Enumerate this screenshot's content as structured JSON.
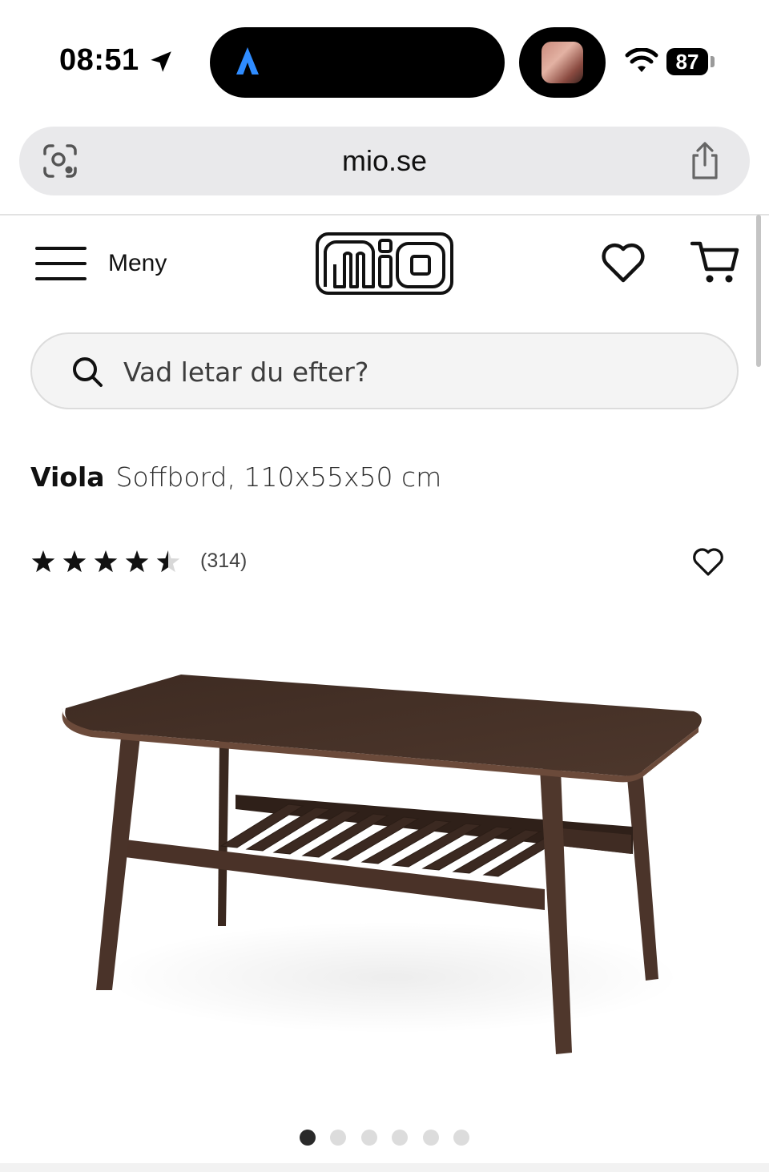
{
  "status_bar": {
    "time": "08:51",
    "battery": "87",
    "icons": [
      "location-arrow-icon",
      "navigation-a-icon",
      "wifi-icon",
      "battery-icon"
    ]
  },
  "browser": {
    "url": "mio.se",
    "icons": [
      "lens-icon",
      "share-icon"
    ]
  },
  "header": {
    "menu_label": "Meny",
    "logo_text": "mio",
    "icons": [
      "hamburger-menu-icon",
      "heart-icon",
      "cart-icon"
    ]
  },
  "search": {
    "placeholder": "Vad letar du efter?"
  },
  "product": {
    "name": "Viola",
    "description": "Soffbord, 110x55x50 cm",
    "rating": 4.5,
    "rating_max": 5,
    "review_count": "(314)",
    "image_icon": "coffee-table-image"
  },
  "carousel": {
    "total": 6,
    "active_index": 0
  },
  "colors": {
    "wood": "#4a3429",
    "accent_nav": "#2f8cff",
    "url_bar": "#e9e9eb",
    "dot_active": "#2a2a2a",
    "dot_inactive": "#dcdcdc"
  }
}
